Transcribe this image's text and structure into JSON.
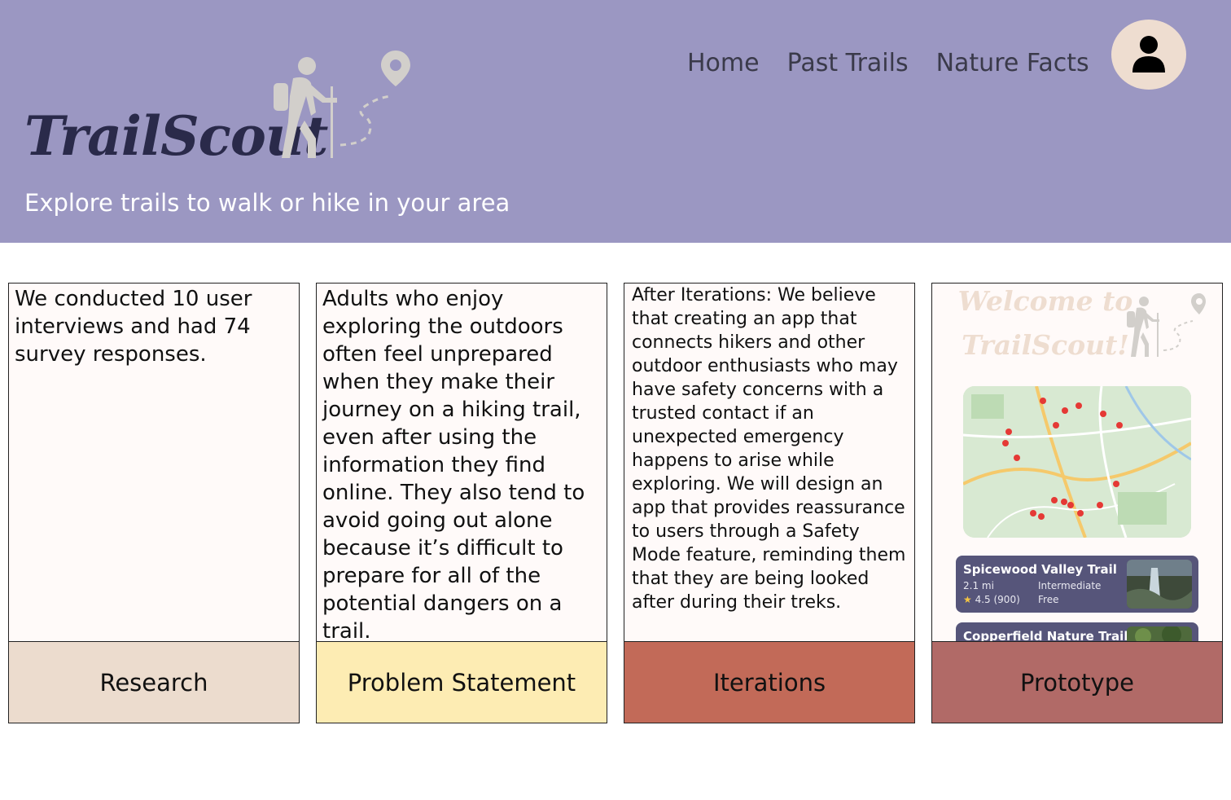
{
  "header": {
    "brand": "TrailScout",
    "tagline": "Explore trails to walk or hike in your area",
    "nav": [
      "Home",
      "Past Trails",
      "Nature Facts"
    ],
    "logo_icon": "hiker-with-map-pin-icon",
    "avatar_icon": "user-icon",
    "bg_color": "#9b97c2"
  },
  "cards": [
    {
      "label": "Research",
      "text": "We conducted 10 user interviews and had 74 survey responses.",
      "label_color": "#ecdcce"
    },
    {
      "label": "Problem Statement",
      "text": "Adults who enjoy exploring the outdoors often feel unprepared when they make their journey on a hiking trail, even after using the information they find online. They also tend to avoid going out alone because it’s difficult to prepare for all of the potential dangers on a trail.",
      "label_color": "#fdecb3"
    },
    {
      "label": "Iterations",
      "text": "After Iterations: We believe that creating an app that connects hikers and other outdoor enthusiasts who may have safety concerns with a trusted contact if an unexpected emergency happens to arise while exploring. We will design an app that provides reassurance to users through a Safety Mode feature, reminding them that they are being looked after during their treks.",
      "label_color": "#c26a58"
    },
    {
      "label": "Prototype",
      "label_color": "#b16a67",
      "preview": {
        "title_line1": "Welcome to",
        "title_line2": "TrailScout!",
        "trails": [
          {
            "name": "Spicewood Valley Trail",
            "distance": "2.1 mi",
            "difficulty": "Intermediate",
            "rating": "4.5 (900)",
            "price": "Free"
          },
          {
            "name": "Copperfield Nature Trail"
          }
        ]
      }
    }
  ]
}
